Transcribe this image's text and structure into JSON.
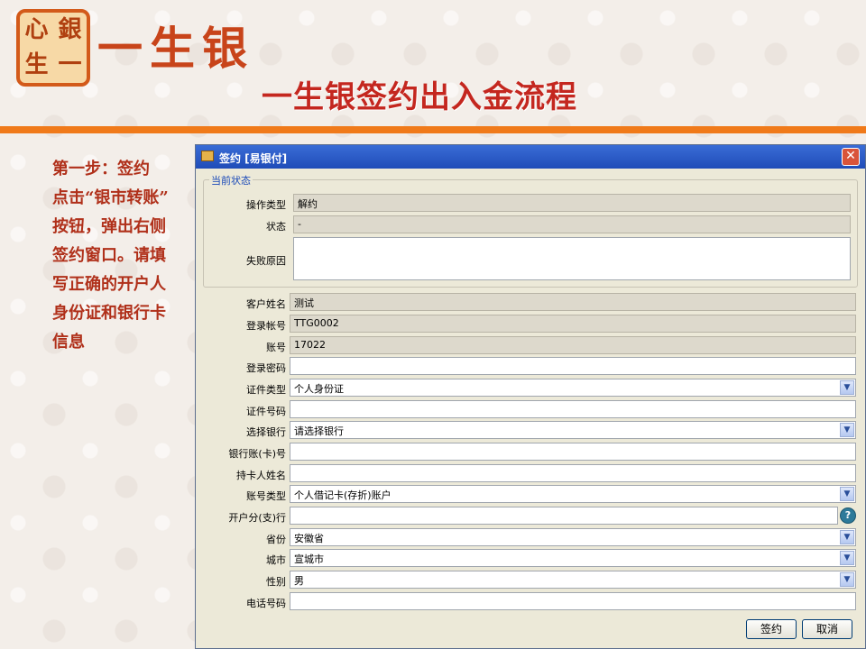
{
  "header": {
    "logo_seal_chars": [
      "心",
      "銀",
      "生",
      "一"
    ],
    "logo_text": "一生银",
    "title": "一生银签约出入金流程"
  },
  "instructions": "第一步：签约\n点击“银市转账”\n按钮，弹出右侧\n签约窗口。请填\n写正确的开户人\n身份证和银行卡\n信息",
  "dialog": {
    "title": "签约 [易银付]",
    "status_group": {
      "legend": "当前状态",
      "operation_type": {
        "label": "操作类型",
        "value": "解约"
      },
      "status": {
        "label": "状态",
        "value": "-"
      },
      "fail_reason": {
        "label": "失败原因",
        "value": ""
      }
    },
    "fields": {
      "customer_name": {
        "label": "客户姓名",
        "value": "测试"
      },
      "login_account": {
        "label": "登录帐号",
        "value": "TTG0002"
      },
      "account_no": {
        "label": "账号",
        "value": "17022"
      },
      "login_password": {
        "label": "登录密码",
        "value": ""
      },
      "id_type": {
        "label": "证件类型",
        "value": "个人身份证"
      },
      "id_number": {
        "label": "证件号码",
        "value": ""
      },
      "bank": {
        "label": "选择银行",
        "value": "请选择银行"
      },
      "bank_card": {
        "label": "银行账(卡)号",
        "value": ""
      },
      "cardholder": {
        "label": "持卡人姓名",
        "value": ""
      },
      "account_type": {
        "label": "账号类型",
        "value": "个人借记卡(存折)账户"
      },
      "branch": {
        "label": "开户分(支)行",
        "value": ""
      },
      "province": {
        "label": "省份",
        "value": "安徽省"
      },
      "city": {
        "label": "城市",
        "value": "宣城市"
      },
      "gender": {
        "label": "性别",
        "value": "男"
      },
      "phone": {
        "label": "电话号码",
        "value": ""
      }
    },
    "buttons": {
      "sign": "签约",
      "cancel": "取消"
    },
    "close_glyph": "✕",
    "help_glyph": "?",
    "chevron_glyph": "▼"
  },
  "colors": {
    "accent_orange": "#f07a1a",
    "title_red": "#c4271f",
    "titlebar_blue": "#1f4cb8"
  }
}
